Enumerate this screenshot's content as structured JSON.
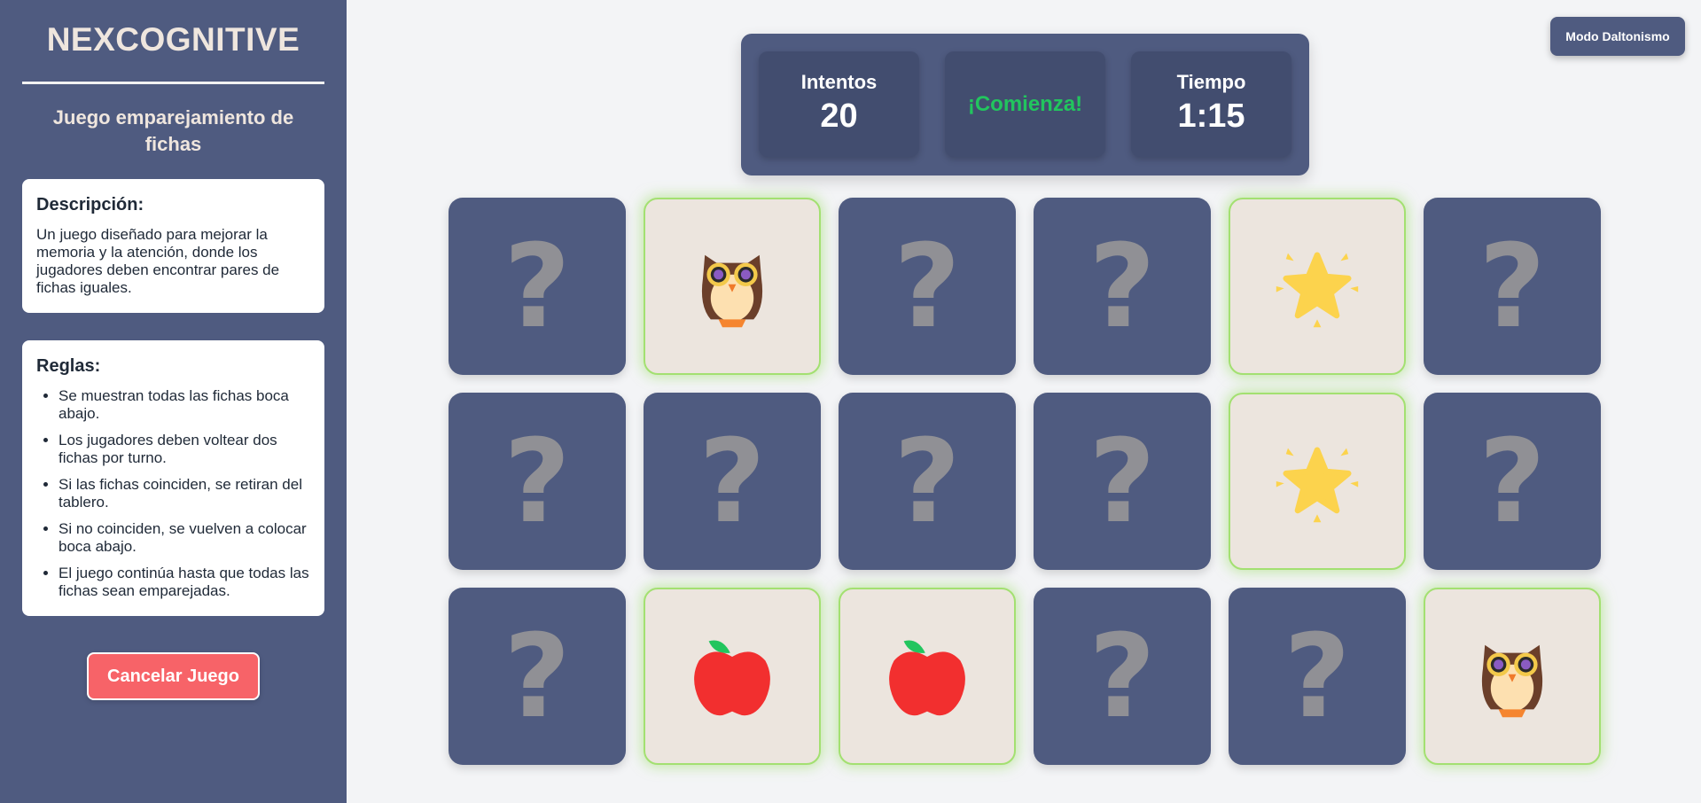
{
  "sidebar": {
    "brand": "NEXCOGNITIVE",
    "subtitle": "Juego emparejamiento de fichas",
    "description": {
      "title": "Descripción:",
      "text": "Un juego diseñado para mejorar la memoria y la atención, donde los jugadores deben encontrar pares de fichas iguales."
    },
    "rules": {
      "title": "Reglas:",
      "items": [
        "Se muestran todas las fichas boca abajo.",
        "Los jugadores deben voltear dos fichas por turno.",
        "Si las fichas coinciden, se retiran del tablero.",
        "Si no coinciden, se vuelven a colocar boca abajo.",
        "El juego continúa hasta que todas las fichas sean emparejadas."
      ]
    },
    "cancel_label": "Cancelar Juego"
  },
  "header": {
    "colorblind_label": "Modo Daltonismo"
  },
  "stats": {
    "attempts_label": "Intentos",
    "attempts_value": "20",
    "status_message": "¡Comienza!",
    "time_label": "Tiempo",
    "time_value": "1:15"
  },
  "board": {
    "hidden_symbol": "?",
    "tiles": [
      {
        "state": "hidden"
      },
      {
        "state": "revealed",
        "icon": "owl-icon"
      },
      {
        "state": "hidden"
      },
      {
        "state": "hidden"
      },
      {
        "state": "revealed",
        "icon": "star-icon"
      },
      {
        "state": "hidden"
      },
      {
        "state": "hidden"
      },
      {
        "state": "hidden"
      },
      {
        "state": "hidden"
      },
      {
        "state": "hidden"
      },
      {
        "state": "revealed",
        "icon": "star-icon"
      },
      {
        "state": "hidden"
      },
      {
        "state": "hidden"
      },
      {
        "state": "revealed",
        "icon": "apple-icon"
      },
      {
        "state": "revealed",
        "icon": "apple-icon"
      },
      {
        "state": "hidden"
      },
      {
        "state": "hidden"
      },
      {
        "state": "revealed",
        "icon": "owl-icon"
      }
    ]
  },
  "colors": {
    "panel": "#4f5b80",
    "accent_green": "#22c55e",
    "cancel_red": "#f76368",
    "match_glow": "#a3e071"
  }
}
